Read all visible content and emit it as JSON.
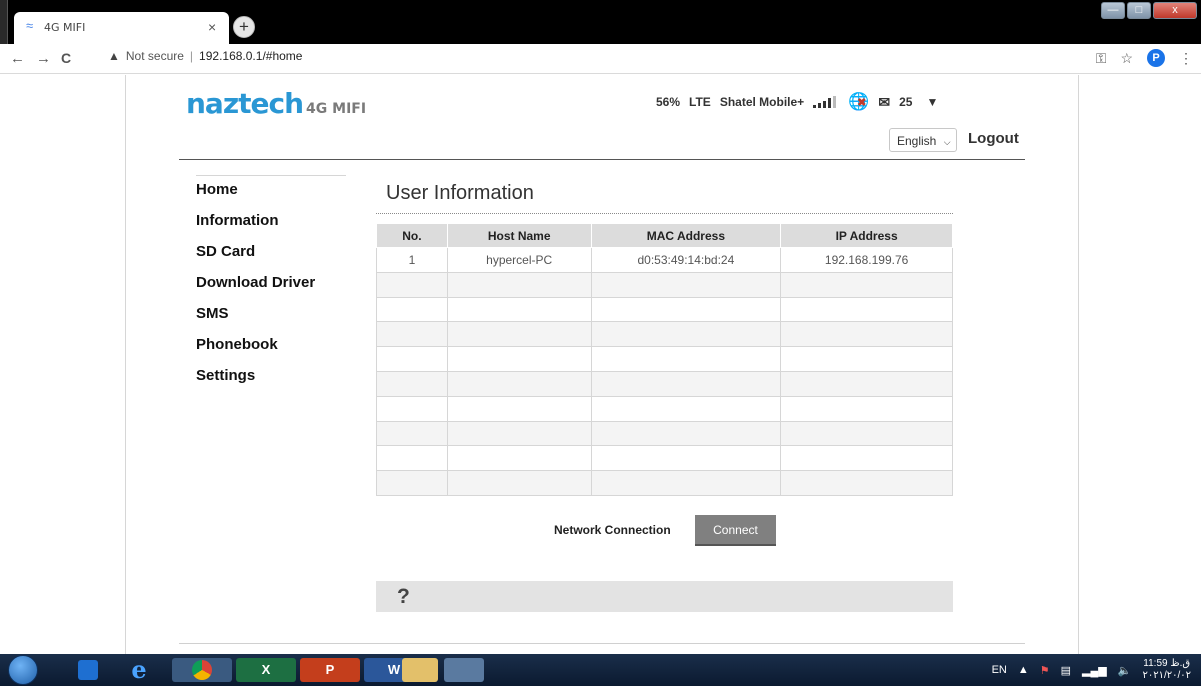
{
  "browser": {
    "tab": {
      "title": "4G MIFI",
      "close_glyph": "×"
    },
    "new_tab_glyph": "+",
    "window_controls": {
      "minimize": "—",
      "maximize": "□",
      "close": "x"
    },
    "nav": {
      "back": "←",
      "forward": "→",
      "reload": "C"
    },
    "address": {
      "security_label": "Not secure",
      "url": "192.168.0.1/#home"
    },
    "toolbar": {
      "key_icon": "key-icon",
      "star_icon": "star-icon",
      "profile_initial": "P",
      "menu_glyph": "⋮"
    }
  },
  "header": {
    "brand": "naztech",
    "model": "4G MIFI",
    "battery": "56%",
    "network_type": "LTE",
    "carrier": "Shatel Mobile+",
    "sms_count": "25",
    "language": "English",
    "logout_label": "Logout"
  },
  "sidebar": {
    "items": [
      {
        "label": "Home"
      },
      {
        "label": "Information"
      },
      {
        "label": "SD Card"
      },
      {
        "label": "Download Driver"
      },
      {
        "label": "SMS"
      },
      {
        "label": "Phonebook"
      },
      {
        "label": "Settings"
      }
    ]
  },
  "main": {
    "title": "User Information",
    "table": {
      "columns": [
        "No.",
        "Host Name",
        "MAC Address",
        "IP Address"
      ],
      "rows": [
        [
          "1",
          "hypercel-PC",
          "d0:53:49:14:bd:24",
          "192.168.199.76"
        ],
        [
          "",
          "",
          "",
          ""
        ],
        [
          "",
          "",
          "",
          ""
        ],
        [
          "",
          "",
          "",
          ""
        ],
        [
          "",
          "",
          "",
          ""
        ],
        [
          "",
          "",
          "",
          ""
        ],
        [
          "",
          "",
          "",
          ""
        ],
        [
          "",
          "",
          "",
          ""
        ],
        [
          "",
          "",
          "",
          ""
        ],
        [
          "",
          "",
          "",
          ""
        ]
      ]
    },
    "network_connection_label": "Network Connection",
    "connect_label": "Connect",
    "help_glyph": "?"
  },
  "taskbar": {
    "apps": [
      {
        "name": "media-player-icon",
        "label": ""
      },
      {
        "name": "internet-explorer-icon",
        "label": "e"
      },
      {
        "name": "chrome-icon",
        "label": ""
      },
      {
        "name": "excel-icon",
        "label": "X"
      },
      {
        "name": "powerpoint-icon",
        "label": "P"
      },
      {
        "name": "word-icon",
        "label": "W"
      },
      {
        "name": "file-explorer-icon",
        "label": ""
      },
      {
        "name": "paint-icon",
        "label": ""
      }
    ],
    "tray": {
      "language": "EN",
      "time": "11:59 ق.ظ",
      "date": "۲۰۲۱/۲۰/۰۲"
    }
  }
}
